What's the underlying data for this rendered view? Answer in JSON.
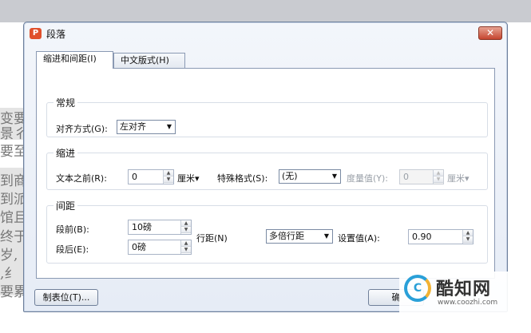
{
  "dialog": {
    "title": "段落",
    "app_icon_letter": "P",
    "close_symbol": "✕"
  },
  "tabs": [
    {
      "label": "缩进和间距(I)",
      "active": true
    },
    {
      "label": "中文版式(H)",
      "active": false
    }
  ],
  "general": {
    "title": "常规",
    "alignment_label": "对齐方式(G):",
    "alignment_value": "左对齐"
  },
  "indent": {
    "title": "缩进",
    "before_text_label": "文本之前(R):",
    "before_text_value": "0",
    "before_text_unit": "厘米▾",
    "special_label": "特殊格式(S):",
    "special_value": "(无)",
    "measure_label": "度量值(Y):",
    "measure_value": "0",
    "measure_unit": "厘米▾"
  },
  "spacing": {
    "title": "间距",
    "before_label": "段前(B):",
    "before_value": "10磅",
    "after_label": "段后(E):",
    "after_value": "0磅",
    "line_spacing_label": "行距(N)",
    "line_spacing_value": "多倍行距",
    "set_value_label": "设置值(A):",
    "set_value": "0.90"
  },
  "footer": {
    "tabs_button_label": "制表位(T)...",
    "ok_button_partial": "确"
  },
  "background_text": [
    "变要",
    "景彳",
    "要至",
    "到商",
    "到派",
    "馆且",
    "终于",
    "岁,",
    ",纟",
    "要累"
  ],
  "watermark": {
    "name": "酷知网",
    "url": "www.coozhi.com",
    "logo_letter": "C"
  },
  "colors": {
    "accent_close": "#c5452f",
    "app_icon": "#e0502c",
    "watermark_blue": "#2aa0d8",
    "watermark_orange": "#f2b233"
  }
}
